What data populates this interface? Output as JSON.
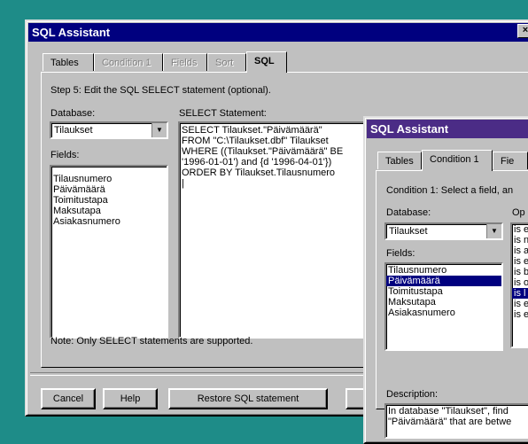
{
  "main_window": {
    "title": "SQL Assistant",
    "close_glyph": "×",
    "tabs": [
      "Tables",
      "Condition 1",
      "Fields",
      "Sort",
      "SQL"
    ],
    "step_text": "Step 5: Edit the SQL SELECT statement (optional).",
    "database_label": "Database:",
    "database_value": "Tilaukset",
    "fields_label": "Fields:",
    "fields": [
      "Tilausnumero",
      "Päivämäärä",
      "Toimitustapa",
      "Maksutapa",
      "Asiakasnumero"
    ],
    "select_label": "SELECT Statement:",
    "sql_lines": [
      "SELECT Tilaukset.\"Päivämäärä\"",
      "FROM \"C:\\Tilaukset.dbf\" Tilaukset",
      "WHERE ((Tilaukset.\"Päivämäärä\" BE",
      "'1996-01-01') and {d '1996-04-01'})",
      "ORDER BY Tilaukset.Tilausnumero"
    ],
    "note": "Note: Only SELECT statements are supported.",
    "buttons": {
      "cancel": "Cancel",
      "help": "Help",
      "restore": "Restore SQL statement",
      "back": "<"
    }
  },
  "second_window": {
    "title": "SQL Assistant",
    "tabs": [
      "Tables",
      "Condition 1",
      "Fie"
    ],
    "step_text": "Condition 1: Select a field, an",
    "database_label": "Database:",
    "database_value": "Tilaukset",
    "operator_label": "Op",
    "fields_label": "Fields:",
    "fields": [
      "Tilausnumero",
      "Päivämäärä",
      "Toimitustapa",
      "Maksutapa",
      "Asiakasnumero"
    ],
    "selected_field": "Päivämäärä",
    "operators": [
      "is e",
      "is n",
      "is a",
      "is e",
      "is b",
      "is o",
      "is l",
      "is e",
      "is e"
    ],
    "selected_operator_index": 6,
    "description_label": "Description:",
    "description_lines": [
      "In database \"Tilaukset\", find",
      "\"Päivämäärä\" that are betwe"
    ]
  }
}
